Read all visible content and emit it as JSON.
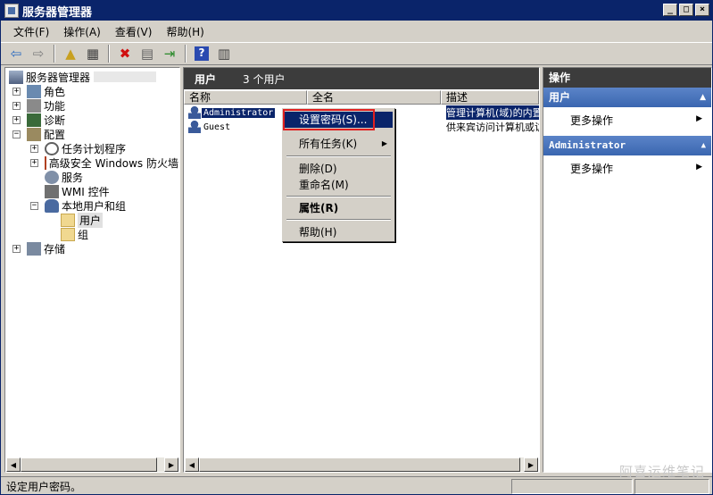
{
  "window": {
    "title": "服务器管理器",
    "btn_min": "_",
    "btn_max": "□",
    "btn_close": "×"
  },
  "menu": [
    "文件(F)",
    "操作(A)",
    "查看(V)",
    "帮助(H)"
  ],
  "tree": {
    "root": "服务器管理器",
    "roles": "角色",
    "features": "功能",
    "diagnostics": "诊断",
    "configuration": "配置",
    "task_scheduler": "任务计划程序",
    "firewall": "高级安全 Windows 防火墙",
    "services": "服务",
    "wmi": "WMI 控件",
    "local_users": "本地用户和组",
    "users": "用户",
    "groups": "组",
    "storage": "存储"
  },
  "center": {
    "header_title": "用户",
    "header_count": "3 个用户",
    "columns": [
      "名称",
      "全名",
      "描述"
    ],
    "rows": [
      {
        "name": "Administrator",
        "fullname": "",
        "desc": "管理计算机(域)的内置帐户"
      },
      {
        "name": "Guest",
        "fullname": "",
        "desc": "供来宾访问计算机或访问域的内置帐户"
      }
    ]
  },
  "context_menu": {
    "set_password": "设置密码(S)...",
    "all_tasks": "所有任务(K)",
    "delete": "删除(D)",
    "rename": "重命名(M)",
    "properties": "属性(R)",
    "help": "帮助(H)"
  },
  "actions": {
    "title": "操作",
    "section1": "用户",
    "more1": "更多操作",
    "section2": "Administrator",
    "more2": "更多操作"
  },
  "status": {
    "text": "设定用户密码。"
  },
  "watermark": "阿喜运维笔记",
  "colors": {
    "selection": "#0a246a",
    "highlight_box": "#e02020",
    "action_header": "#3a66b0"
  }
}
